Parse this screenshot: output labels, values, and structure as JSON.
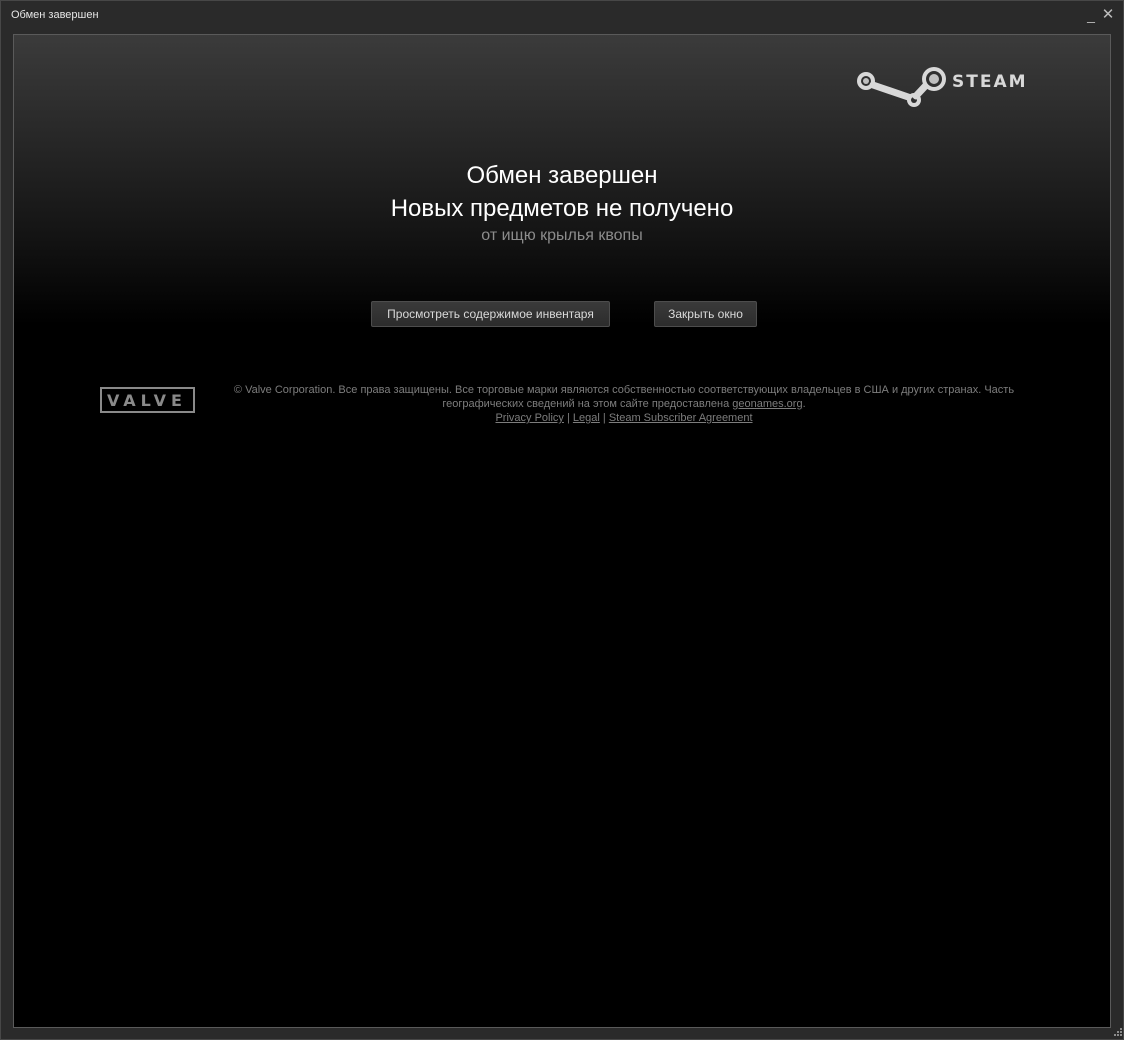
{
  "window": {
    "title": "Обмен завершен",
    "minimize_glyph": "_",
    "close_glyph": "✕"
  },
  "logos": {
    "steam": "STEAM",
    "valve": "VALVE"
  },
  "main": {
    "heading": "Обмен завершен",
    "status": "Новых предметов не получено",
    "partner": "от ищю крылья квопы"
  },
  "buttons": {
    "view_inventory": "Просмотреть содержимое инвентаря",
    "close_window": "Закрыть окно"
  },
  "footer": {
    "copyright": "© Valve Corporation. Все права защищены. Все торговые марки являются собственностью соответствующих владельцев в США и других странах. Часть географических сведений на этом сайте предоставлена",
    "geonames_link": "geonames.org",
    "period": ".",
    "separator": "|",
    "privacy_link": "Privacy Policy",
    "legal_link": "Legal",
    "ssa_link": "Steam Subscriber Agreement"
  },
  "colors": {
    "background": "#000000",
    "window_chrome": "#2a2a2a",
    "button_text": "#d9d9d9",
    "footer_text": "#7d7d7d"
  }
}
